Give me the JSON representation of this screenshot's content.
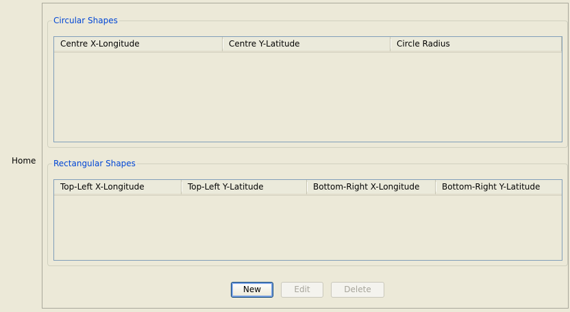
{
  "home_label": "Home",
  "circular": {
    "title": "Circular Shapes",
    "columns": [
      "Centre X-Longitude",
      "Centre Y-Latitude",
      "Circle Radius"
    ],
    "rows": []
  },
  "rectangular": {
    "title": "Rectangular Shapes",
    "columns": [
      "Top-Left X-Longitude",
      "Top-Left Y-Latitude",
      "Bottom-Right X-Longitude",
      "Bottom-Right Y-Latitude"
    ],
    "rows": []
  },
  "buttons": {
    "new": "New",
    "edit": "Edit",
    "delete": "Delete"
  },
  "colors": {
    "group_title": "#0046d5",
    "background": "#ece9d8",
    "table_border": "#7f9db9"
  }
}
